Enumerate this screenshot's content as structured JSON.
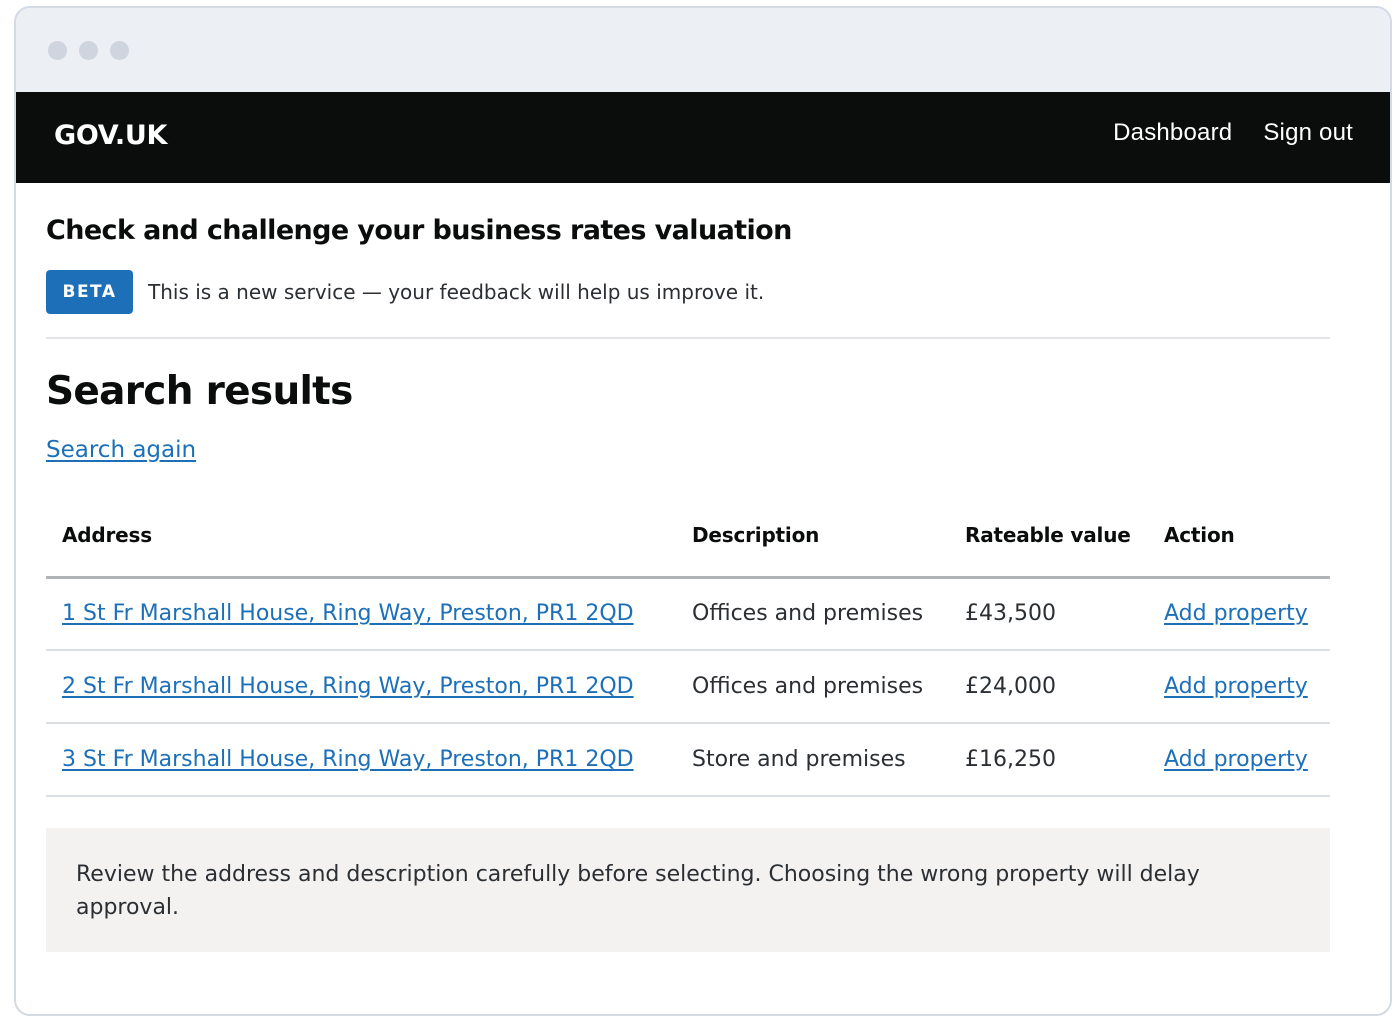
{
  "header": {
    "logo": "GOV.UK",
    "nav": [
      {
        "label": "Dashboard"
      },
      {
        "label": "Sign out"
      }
    ]
  },
  "service": {
    "title": "Check and challenge your business rates valuation",
    "phase_tag": "BETA",
    "phase_text": "This is a new service — your feedback will help us improve it."
  },
  "main": {
    "heading": "Search results",
    "search_again": "Search again",
    "table": {
      "columns": [
        "Address",
        "Description",
        "Rateable value",
        "Action"
      ],
      "rows": [
        {
          "address": "1 St Fr Marshall House, Ring Way, Preston, PR1 2QD",
          "description": "Offices and premises",
          "value": "£43,500",
          "action": "Add property"
        },
        {
          "address": "2 St Fr Marshall House, Ring Way, Preston, PR1 2QD",
          "description": "Offices and premises",
          "value": "£24,000",
          "action": "Add property"
        },
        {
          "address": "3 St Fr Marshall House, Ring Way, Preston, PR1 2QD",
          "description": "Store and premises",
          "value": "£16,250",
          "action": "Add property"
        }
      ]
    },
    "notice": "Review the address and description carefully before selecting. Choosing the wrong property will delay approval."
  },
  "colors": {
    "header_bg": "#0b0c0c",
    "link": "#1d70b8",
    "tag_bg": "#1d70b8",
    "inset_bg": "#f3f2f1"
  }
}
